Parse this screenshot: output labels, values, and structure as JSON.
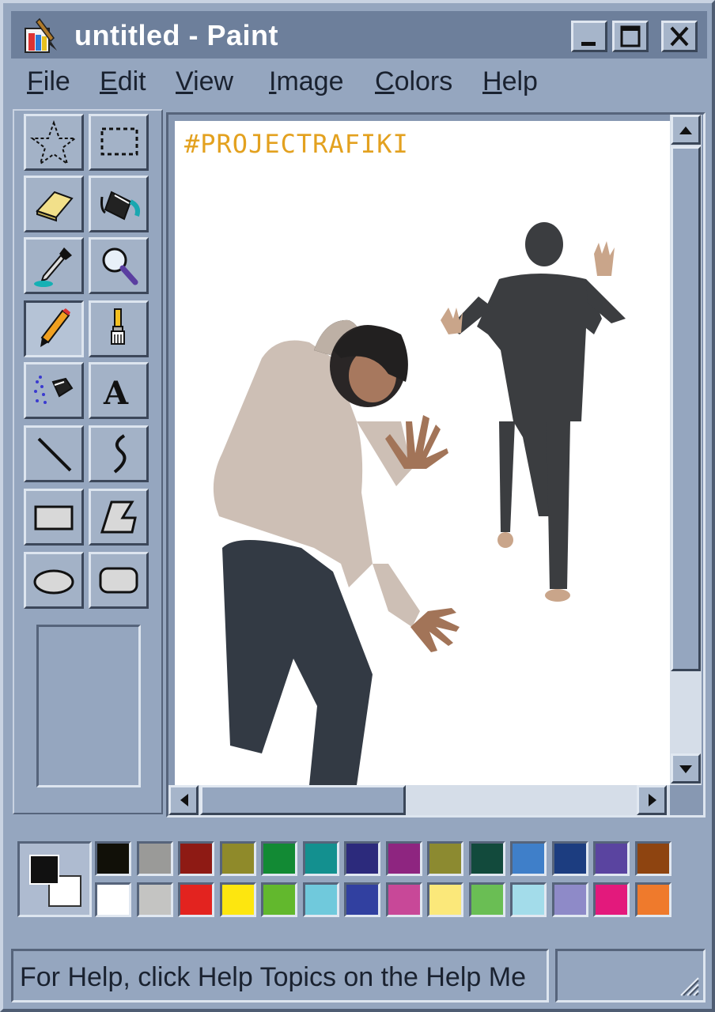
{
  "window": {
    "title": "untitled - Paint",
    "controls": {
      "minimize": "minimize",
      "maximize": "maximize",
      "close": "close"
    }
  },
  "menu": [
    {
      "label": "File",
      "underline": "F",
      "rest": "ile"
    },
    {
      "label": "Edit",
      "underline": "E",
      "rest": "dit"
    },
    {
      "label": "View",
      "underline": "V",
      "rest": "iew"
    },
    {
      "label": "Image",
      "underline": "I",
      "rest": "mage"
    },
    {
      "label": "Colors",
      "underline": "C",
      "rest": "olors"
    },
    {
      "label": "Help",
      "underline": "H",
      "rest": "elp"
    }
  ],
  "tools": [
    {
      "name": "free-form-select",
      "icon": "star-select-icon"
    },
    {
      "name": "select",
      "icon": "rect-select-icon"
    },
    {
      "name": "eraser",
      "icon": "eraser-icon"
    },
    {
      "name": "fill-with-color",
      "icon": "paint-bucket-icon"
    },
    {
      "name": "pick-color",
      "icon": "eyedropper-icon"
    },
    {
      "name": "magnifier",
      "icon": "magnifier-icon"
    },
    {
      "name": "pencil",
      "icon": "pencil-icon",
      "active": true
    },
    {
      "name": "brush",
      "icon": "brush-icon"
    },
    {
      "name": "airbrush",
      "icon": "airbrush-icon"
    },
    {
      "name": "text",
      "icon": "text-icon"
    },
    {
      "name": "line",
      "icon": "line-icon"
    },
    {
      "name": "curve",
      "icon": "curve-icon"
    },
    {
      "name": "rectangle",
      "icon": "rectangle-icon"
    },
    {
      "name": "polygon",
      "icon": "polygon-icon"
    },
    {
      "name": "ellipse",
      "icon": "ellipse-icon"
    },
    {
      "name": "rounded-rectangle",
      "icon": "rounded-rect-icon"
    }
  ],
  "canvas": {
    "overlay_text": "#PROJECTRAFIKI",
    "overlay_color": "#e3a11f"
  },
  "palette": {
    "foreground": "#111111",
    "background": "#ffffff",
    "top_row": [
      "#111008",
      "#9a9a98",
      "#8e1a14",
      "#8f8a2a",
      "#128a34",
      "#13908f",
      "#2c2a7c",
      "#8e2580",
      "#8c8a30",
      "#124a3c",
      "#3f7fc9",
      "#1c3d80",
      "#5a44a0",
      "#8e4410"
    ],
    "bottom_row": [
      "#ffffff",
      "#c4c4c2",
      "#e3231f",
      "#fde60f",
      "#62b82d",
      "#70c9dc",
      "#3140a0",
      "#c84898",
      "#fbe87a",
      "#6abe54",
      "#a3dcea",
      "#8e8ac8",
      "#e3197c",
      "#ef7a2c"
    ]
  },
  "status": {
    "text": "For Help, click Help Topics on the Help Me"
  }
}
